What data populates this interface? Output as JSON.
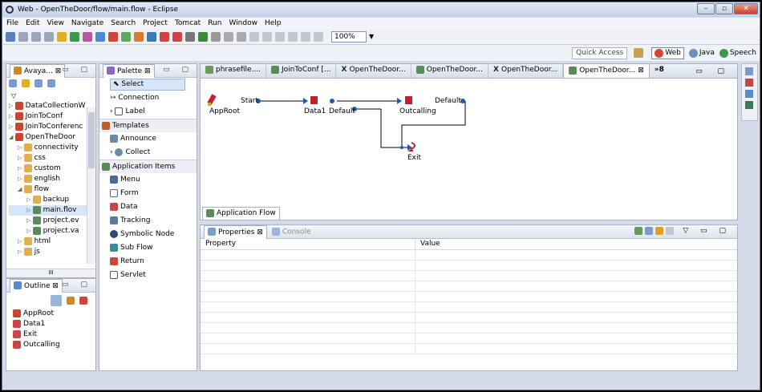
{
  "window": {
    "title": "Web - OpenTheDoor/flow/main.flow - Eclipse"
  },
  "menu": [
    "File",
    "Edit",
    "View",
    "Navigate",
    "Search",
    "Project",
    "Tomcat",
    "Run",
    "Window",
    "Help"
  ],
  "toolbar": {
    "zoom": "100%"
  },
  "quick_access": "Quick Access",
  "perspectives": [
    {
      "label": "Web",
      "active": true
    },
    {
      "label": "Java"
    },
    {
      "label": "Speech"
    }
  ],
  "navigator": {
    "tab": "Avaya...",
    "tree": [
      {
        "label": "DataCollectionW",
        "depth": 0
      },
      {
        "label": "JoinToConf",
        "depth": 0
      },
      {
        "label": "JoinToConferenc",
        "depth": 0
      },
      {
        "label": "OpenTheDoor",
        "depth": 0
      },
      {
        "label": "connectivity",
        "depth": 1
      },
      {
        "label": "css",
        "depth": 1
      },
      {
        "label": "custom",
        "depth": 1
      },
      {
        "label": "english",
        "depth": 1
      },
      {
        "label": "flow",
        "depth": 1
      },
      {
        "label": "backup",
        "depth": 2
      },
      {
        "label": "main.flov",
        "depth": 2
      },
      {
        "label": "project.ev",
        "depth": 2
      },
      {
        "label": "project.va",
        "depth": 2
      },
      {
        "label": "html",
        "depth": 1
      },
      {
        "label": "js",
        "depth": 1
      }
    ],
    "scroll_label": "III"
  },
  "outline": {
    "tab": "Outline",
    "items": [
      "AppRoot",
      "Data1",
      "Exit",
      "Outcalling"
    ]
  },
  "palette": {
    "tab": "Palette",
    "tools": [
      "Select",
      "Connection",
      "Label"
    ],
    "drawers": [
      {
        "label": "Templates",
        "items": [
          "Announce",
          "Collect"
        ]
      },
      {
        "label": "Application Items",
        "items": [
          "Menu",
          "Form",
          "Data",
          "Tracking",
          "Symbolic Node",
          "Sub Flow",
          "Return",
          "Servlet"
        ]
      }
    ]
  },
  "editor": {
    "tabs": [
      "phrasefile....",
      "JoinToConf [...",
      "OpenTheDoor...",
      "OpenTheDoor...",
      "OpenTheDoor...",
      "OpenTheDoor..."
    ],
    "more": "»8",
    "canvas_tab": "Application Flow",
    "nodes": {
      "approot": "AppRoot",
      "start": "Start",
      "data1": "Data1",
      "default1": "Default",
      "outcalling": "Outcalling",
      "default2": "Default",
      "exit": "Exit"
    }
  },
  "properties": {
    "tab": "Properties",
    "console": "Console",
    "headers": [
      "Property",
      "Value"
    ]
  }
}
